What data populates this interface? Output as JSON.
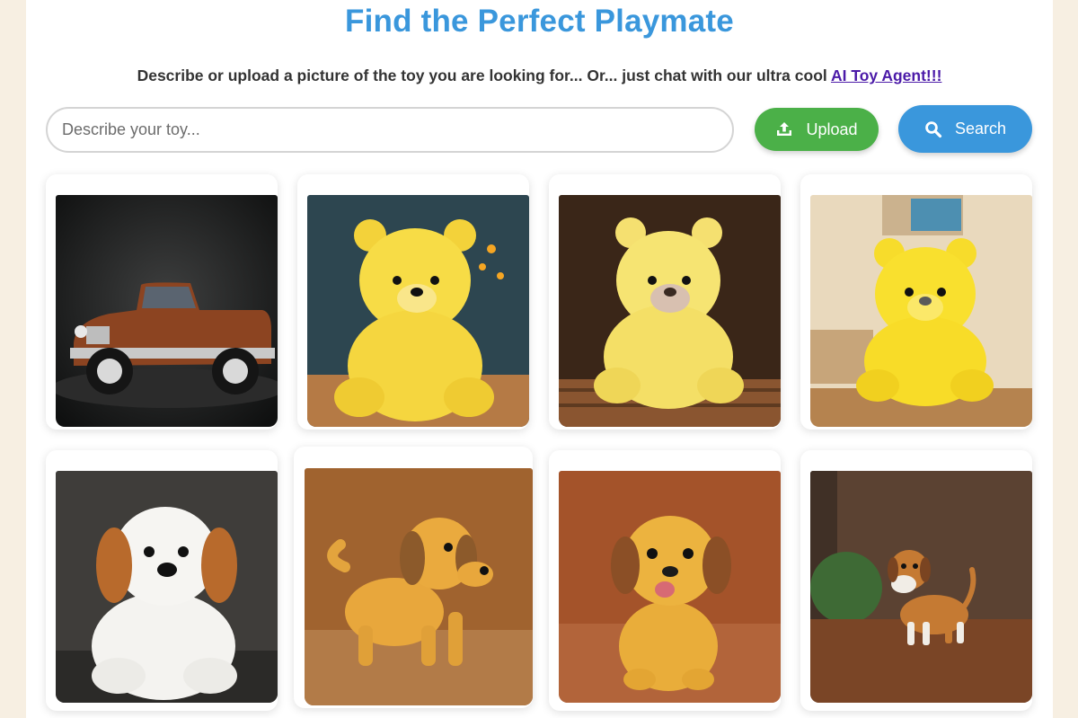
{
  "header": {
    "title": "Find the Perfect Playmate",
    "subtitle_text": "Describe or upload a picture of the toy you are looking for... Or... just chat with our ultra cool ",
    "agent_link": "AI Toy Agent!!!"
  },
  "search": {
    "placeholder": "Describe your toy...",
    "value": ""
  },
  "buttons": {
    "upload_label": "Upload",
    "search_label": "Search"
  },
  "colors": {
    "title": "#3a97dc",
    "upload": "#4bb048",
    "search": "#3a97dc",
    "page_bg": "#f7efe2",
    "link": "#4b1aa8"
  },
  "results": [
    {
      "icon": "toy-car-image"
    },
    {
      "icon": "yellow-teddy-bear-image"
    },
    {
      "icon": "yellow-teddy-bear-image"
    },
    {
      "icon": "yellow-teddy-bear-image"
    },
    {
      "icon": "white-plush-dog-image"
    },
    {
      "icon": "toy-dog-figurine-image"
    },
    {
      "icon": "toy-puppy-figurine-image"
    },
    {
      "icon": "toy-beagle-figurine-image"
    }
  ]
}
